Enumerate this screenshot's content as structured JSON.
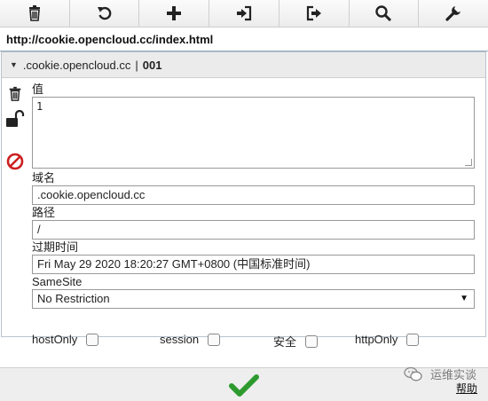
{
  "toolbar": {
    "buttons": [
      {
        "name": "trash-icon"
      },
      {
        "name": "refresh-icon"
      },
      {
        "name": "plus-icon"
      },
      {
        "name": "import-icon"
      },
      {
        "name": "export-icon"
      },
      {
        "name": "search-icon"
      },
      {
        "name": "wrench-icon"
      }
    ]
  },
  "url": "http://cookie.opencloud.cc/index.html",
  "cookie": {
    "domain_header": ".cookie.opencloud.cc",
    "separator": "|",
    "id_header": "001",
    "value_label": "值",
    "value": "1",
    "domain_label": "域名",
    "domain": ".cookie.opencloud.cc",
    "path_label": "路径",
    "path": "/",
    "expires_label": "过期时间",
    "expires": "Fri May 29 2020 18:20:27 GMT+0800 (中国标准时间)",
    "samesite_label": "SameSite",
    "samesite": "No Restriction",
    "host_only_label": "hostOnly",
    "session_label": "session",
    "secure_label": "安全",
    "http_only_label": "httpOnly"
  },
  "footer": {
    "help_label": "帮助",
    "watermark_text": "运维实谈"
  },
  "colors": {
    "ok_green": "#2e9a2e",
    "block_red": "#cc1f1f"
  }
}
